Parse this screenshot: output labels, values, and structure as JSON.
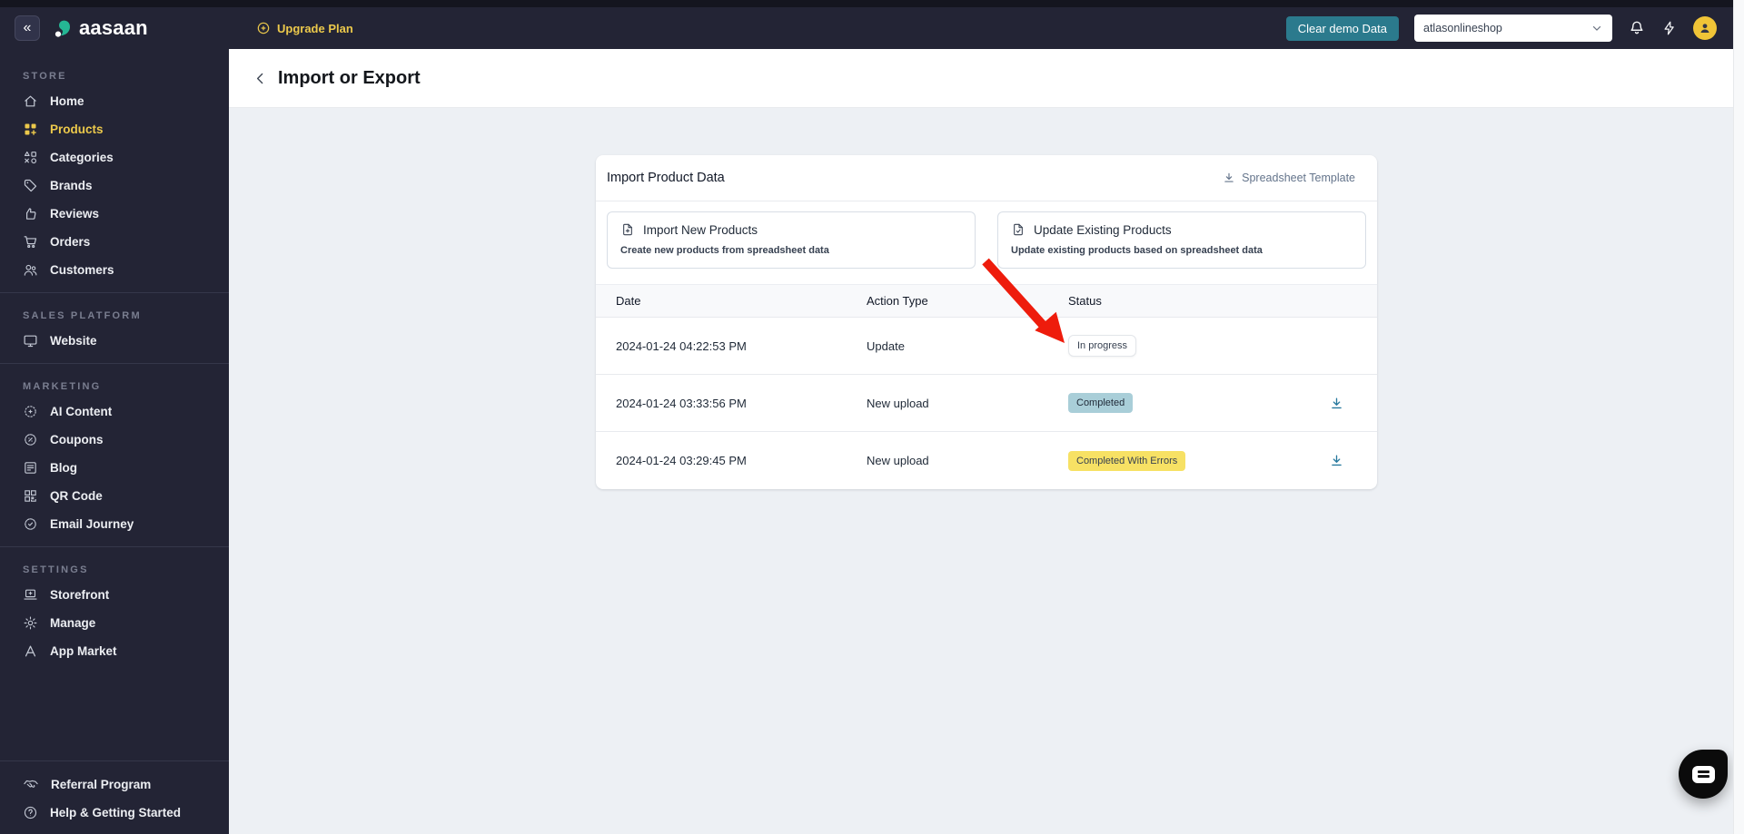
{
  "topbar": {
    "collapse_label": "«",
    "brand": "aasaan",
    "upgrade_plan_label": "Upgrade Plan",
    "clear_demo_label": "Clear demo Data",
    "store_selector_value": "atlasonlineshop"
  },
  "sidebar": {
    "sections": [
      {
        "label": "STORE",
        "items": [
          {
            "label": "Home",
            "icon": "home-icon"
          },
          {
            "label": "Products",
            "icon": "products-icon",
            "active": true
          },
          {
            "label": "Categories",
            "icon": "categories-icon"
          },
          {
            "label": "Brands",
            "icon": "brands-icon"
          },
          {
            "label": "Reviews",
            "icon": "reviews-icon"
          },
          {
            "label": "Orders",
            "icon": "orders-icon"
          },
          {
            "label": "Customers",
            "icon": "customers-icon"
          }
        ]
      },
      {
        "label": "SALES PLATFORM",
        "items": [
          {
            "label": "Website",
            "icon": "website-icon"
          }
        ]
      },
      {
        "label": "MARKETING",
        "items": [
          {
            "label": "AI Content",
            "icon": "ai-content-icon"
          },
          {
            "label": "Coupons",
            "icon": "coupons-icon"
          },
          {
            "label": "Blog",
            "icon": "blog-icon"
          },
          {
            "label": "QR Code",
            "icon": "qr-code-icon"
          },
          {
            "label": "Email Journey",
            "icon": "email-journey-icon"
          }
        ]
      },
      {
        "label": "SETTINGS",
        "items": [
          {
            "label": "Storefront",
            "icon": "storefront-icon"
          },
          {
            "label": "Manage",
            "icon": "manage-icon"
          },
          {
            "label": "App Market",
            "icon": "app-market-icon"
          }
        ]
      }
    ],
    "footer_items": [
      {
        "label": "Referral Program",
        "icon": "referral-icon"
      },
      {
        "label": "Help & Getting Started",
        "icon": "help-icon"
      }
    ]
  },
  "page": {
    "title": "Import or Export"
  },
  "import_card": {
    "title": "Import Product Data",
    "template_link_label": "Spreadsheet Template",
    "options": [
      {
        "title": "Import New Products",
        "desc": "Create new products from spreadsheet data"
      },
      {
        "title": "Update Existing Products",
        "desc": "Update existing products based on spreadsheet data"
      }
    ],
    "table": {
      "headers": [
        "Date",
        "Action Type",
        "Status"
      ],
      "rows": [
        {
          "date": "2024-01-24 04:22:53 PM",
          "action": "Update",
          "status": "In progress",
          "status_type": "in-progress",
          "downloadable": false
        },
        {
          "date": "2024-01-24 03:33:56 PM",
          "action": "New upload",
          "status": "Completed",
          "status_type": "completed",
          "downloadable": true
        },
        {
          "date": "2024-01-24 03:29:45 PM",
          "action": "New upload",
          "status": "Completed With Errors",
          "status_type": "completed-with-errors",
          "downloadable": true
        }
      ]
    }
  },
  "colors": {
    "accent_yellow": "#ecc94b",
    "teal": "#2b7a8d",
    "badge_completed": "#a9ced8",
    "badge_errors": "#f7e164",
    "arrow_red": "#ee1c0c",
    "dl_blue": "#27799e"
  }
}
